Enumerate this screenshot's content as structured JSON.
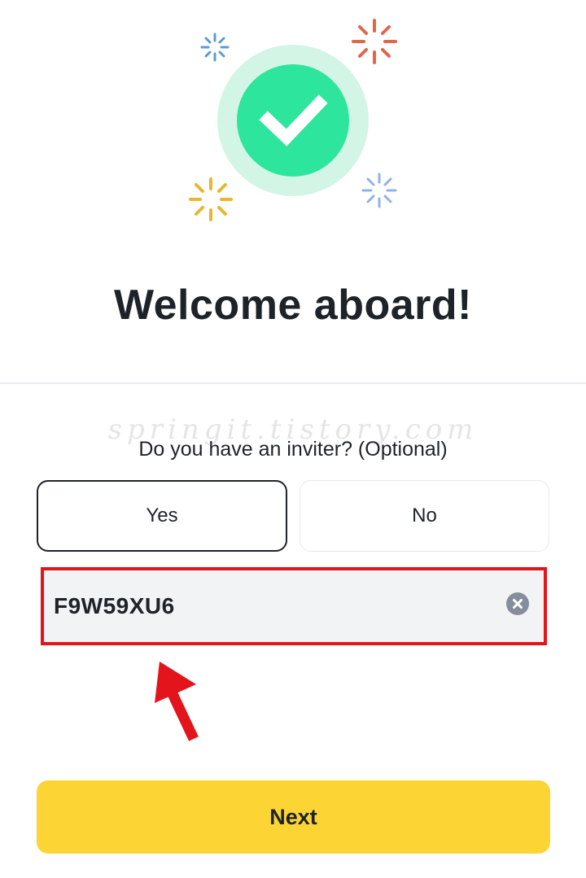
{
  "header": {
    "title": "Welcome aboard!"
  },
  "watermark": "springit.tistory.com",
  "inviter": {
    "question": "Do you have an inviter? (Optional)",
    "yes_label": "Yes",
    "no_label": "No",
    "selected": "Yes",
    "referral_code": "F9W59XU6"
  },
  "footer": {
    "next_label": "Next"
  },
  "colors": {
    "success_green": "#2ee59d",
    "halo_green": "#d3f5e6",
    "highlight_red": "#e3141b",
    "primary_yellow": "#fcd535",
    "spark_blue": "#5b9bd5",
    "spark_orange": "#e2664a",
    "spark_yellow": "#e8b72f",
    "spark_light_blue": "#8fb3e8"
  },
  "icons": {
    "hero": "check-icon",
    "decorations": [
      "sparkle-icon"
    ],
    "clear": "clear-circle-x-icon",
    "annotation": "red-arrow-icon"
  }
}
